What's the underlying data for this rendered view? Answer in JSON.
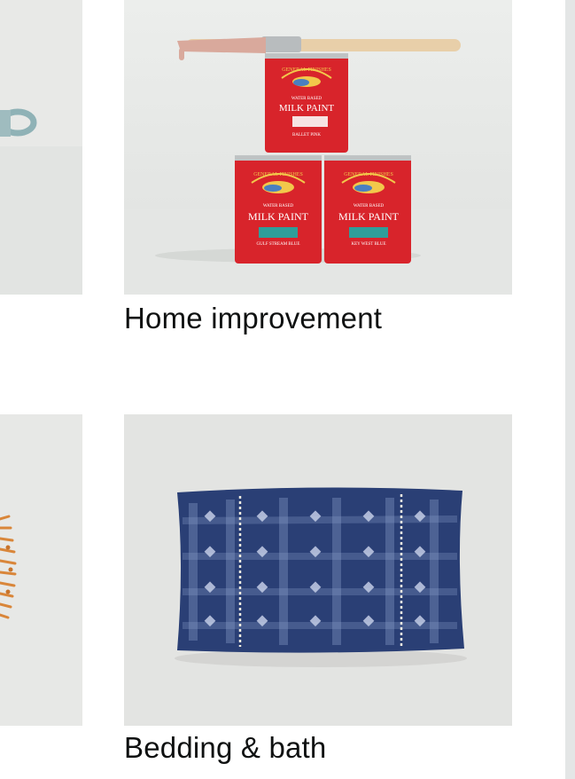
{
  "grid": {
    "items": [
      {
        "caption": "Home improvement",
        "image_icon": "milk-paint-cans-with-brush-icon",
        "can_top": {
          "brand": "GENERAL FINISHES",
          "tagline": "WATER BASED",
          "product": "MILK PAINT",
          "color_name": "BALLET PINK"
        },
        "can_left": {
          "brand": "GENERAL FINISHES",
          "tagline": "WATER BASED",
          "product": "MILK PAINT",
          "color_name": "GULF STREAM BLUE"
        },
        "can_right": {
          "brand": "GENERAL FINISHES",
          "tagline": "WATER BASED",
          "product": "MILK PAINT",
          "color_name": "KEY WEST BLUE"
        }
      },
      {
        "caption": "Bedding & bath",
        "image_icon": "indigo-lumbar-pillow-icon"
      }
    ],
    "left_partial": [
      {
        "image_icon": "teal-scissors-icon"
      },
      {
        "image_icon": "orange-sunburst-mirror-icon"
      }
    ]
  },
  "colors": {
    "paint_red": "#d8242b",
    "gulf_stream_blue": "#2f9e9a",
    "pillow_indigo": "#2a3f75",
    "tile_bg": "#e9eae8"
  }
}
